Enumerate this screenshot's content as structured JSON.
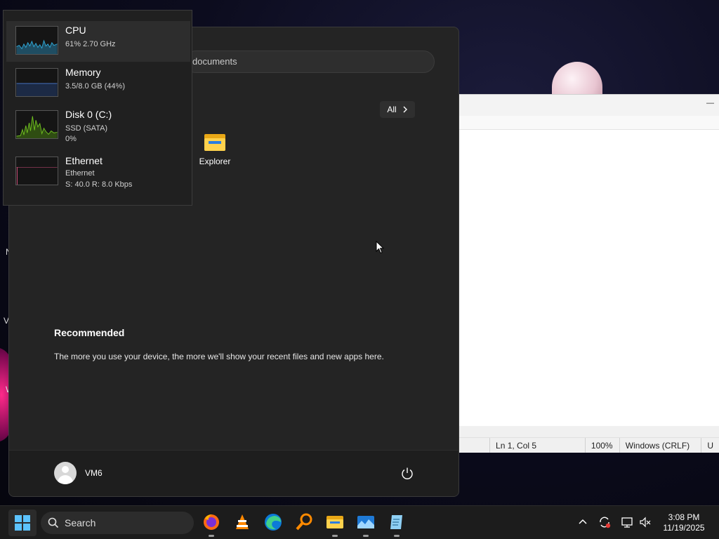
{
  "desktop": {
    "edge_labels": [
      "N",
      "V",
      "W"
    ]
  },
  "notepad": {
    "minimize_glyph": "—",
    "status": {
      "position": "Ln 1, Col 5",
      "zoom": "100%",
      "line_endings": "Windows (CRLF)",
      "encoding_partial": "U"
    }
  },
  "start_menu": {
    "search_placeholder": "documents",
    "all_button": "All",
    "pinned": [
      {
        "label": "Explorer",
        "icon": "folder-icon"
      }
    ],
    "recommended_title": "Recommended",
    "recommended_text": "The more you use your device, the more we'll show your recent files and new apps here.",
    "user_name": "VM6"
  },
  "performance": [
    {
      "name": "CPU",
      "line1": "61% 2.70 GHz",
      "line2": "",
      "color": "#2fa7d6"
    },
    {
      "name": "Memory",
      "line1": "3.5/8.0 GB (44%)",
      "line2": "",
      "color": "#4a7bd1"
    },
    {
      "name": "Disk 0 (C:)",
      "line1": "SSD (SATA)",
      "line2": "0%",
      "color": "#6fbf1f"
    },
    {
      "name": "Ethernet",
      "line1": "Ethernet",
      "line2": "S: 40.0 R: 8.0 Kbps",
      "color": "#d24d7a"
    }
  ],
  "taskbar": {
    "search_label": "Search",
    "apps": [
      "firefox-icon",
      "vlc-icon",
      "edge-icon",
      "search-magnifier-icon",
      "file-explorer-icon",
      "photos-icon",
      "notepad-icon"
    ],
    "time": "3:08 PM",
    "date": "11/19/2025"
  }
}
